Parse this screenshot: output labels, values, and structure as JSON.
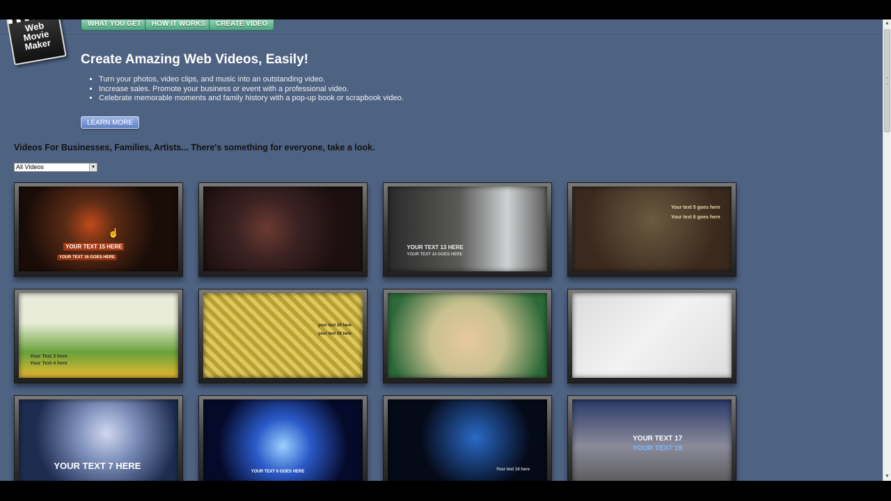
{
  "nav": {
    "items": [
      "WHAT YOU GET",
      "HOW IT WORKS",
      "CREATE VIDEO"
    ]
  },
  "logo": {
    "text": "Web Movie Maker"
  },
  "hero": {
    "title": "Create Amazing Web Videos, Easily!",
    "bullets": [
      "Turn your photos, video clips, and music into an outstanding video.",
      "Increase sales. Promote your business or event with a professional video.",
      "Celebrate memorable moments and family history with a pop-up book or scrapbook video."
    ],
    "learn_more": "LEARN MORE"
  },
  "gallery": {
    "title": "Videos For Businesses, Families, Artists... There's something for everyone, take a look.",
    "filter": {
      "selected": "All Videos"
    },
    "thumbnails": [
      {
        "theme": "dark-performer",
        "colors": [
          "#1a0d08",
          "#5a2b15",
          "#c04a1a"
        ],
        "captions": [
          "YOUR TEXT 15 HERE",
          "YOUR TEXT 16 GOES HERE"
        ]
      },
      {
        "theme": "dark-stage",
        "colors": [
          "#1c0f10",
          "#3b2222",
          "#6b3a30"
        ],
        "captions": []
      },
      {
        "theme": "dark-blocks",
        "colors": [
          "#2a2a2a",
          "#5a5a58",
          "#cfd2d4"
        ],
        "captions": [
          "YOUR TEXT 13 HERE",
          "YOUR TEXT 14 GOES HERE"
        ]
      },
      {
        "theme": "photo-collage-brown",
        "colors": [
          "#3a2a1e",
          "#6a5a40",
          "#4e7a2e"
        ],
        "captions": [
          "Your text 5 goes here",
          "Your text 6 goes here"
        ]
      },
      {
        "theme": "cartoon-zoo",
        "colors": [
          "#e8ecd8",
          "#6aa23a",
          "#e8b830"
        ],
        "captions": [
          "Your Text 3 here",
          "Your Text 4 here"
        ]
      },
      {
        "theme": "baby-hearts-gold",
        "colors": [
          "#b8a032",
          "#e0c860",
          "#8a7a3a"
        ],
        "captions": [
          "your text 28 here",
          "your text 29 here"
        ]
      },
      {
        "theme": "baby-scrapbook",
        "colors": [
          "#c8c090",
          "#2e6a3a",
          "#e8c8a0"
        ],
        "captions": []
      },
      {
        "theme": "white-cubes",
        "colors": [
          "#dcdcdc",
          "#f2f2f2",
          "#b22222"
        ],
        "captions": []
      },
      {
        "theme": "guitar-stage",
        "colors": [
          "#1e2c50",
          "#7a8cb8",
          "#d0d8f0"
        ],
        "captions": [
          "YOUR TEXT 7 HERE"
        ]
      },
      {
        "theme": "blue-neon",
        "colors": [
          "#050a2a",
          "#2a5ac8",
          "#9ad0ff"
        ],
        "captions": [
          "YOUR TEXT 8 GOES HERE"
        ]
      },
      {
        "theme": "hands-guitar",
        "colors": [
          "#050a18",
          "#2a6ac8",
          "#d8a080"
        ],
        "captions": [
          "Your text 14 here"
        ]
      },
      {
        "theme": "building-ruins",
        "colors": [
          "#2a3a6a",
          "#8a8a9a",
          "#5a5a5a"
        ],
        "captions": [
          "YOUR TEXT 17",
          "YOUR TEXT 18"
        ]
      }
    ]
  }
}
